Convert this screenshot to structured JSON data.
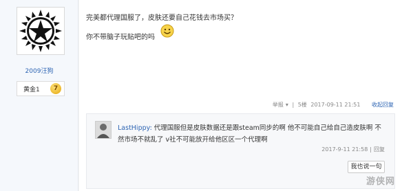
{
  "user": {
    "username": "2009汪狗",
    "level": "黄金1",
    "level_badge": "7"
  },
  "post": {
    "line1": "完美都代理国服了，皮肤还要自己花钱去市场买？",
    "line2": "你不带脑子玩贴吧的吗",
    "meta": {
      "report": "举报",
      "dropdown": "▾",
      "floor": "5楼",
      "date": "2017-09-11 21:51",
      "collapse": "收起回复"
    }
  },
  "reply": {
    "user": "LastHippy:",
    "text": "代理国服但是皮肤数据还是跟steam同步的啊 他不可能自己给自己造皮肤啊 不然市场不就乱了 v社不可能放开给他区区一个代理啊",
    "date": "2017-9-11 21:58",
    "action": "回复",
    "button": "我也说一句"
  },
  "watermark": "游侠网"
}
